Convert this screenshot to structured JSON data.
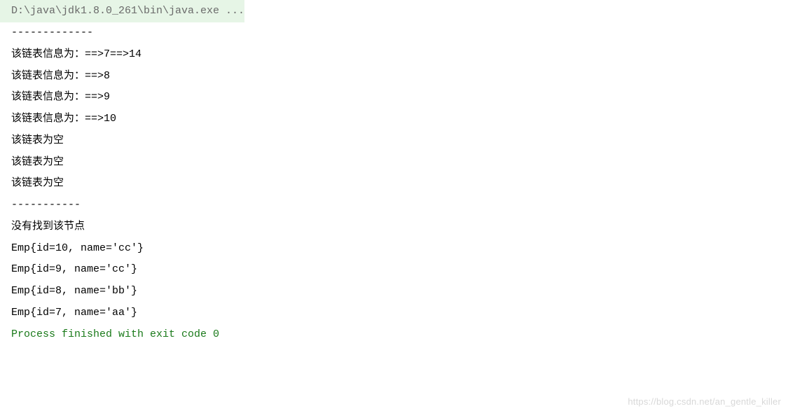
{
  "console": {
    "command": "D:\\java\\jdk1.8.0_261\\bin\\java.exe ...",
    "lines": [
      "-------------",
      "该链表信息为：==>7==>14",
      "该链表信息为：==>8",
      "该链表信息为：==>9",
      "该链表信息为：==>10",
      "该链表为空",
      "该链表为空",
      "该链表为空",
      "-----------",
      "没有找到该节点",
      "Emp{id=10, name='cc'}",
      "Emp{id=9, name='cc'}",
      "Emp{id=8, name='bb'}",
      "Emp{id=7, name='aa'}",
      ""
    ],
    "exit_message": "Process finished with exit code 0"
  },
  "watermark": "https://blog.csdn.net/an_gentle_killer"
}
